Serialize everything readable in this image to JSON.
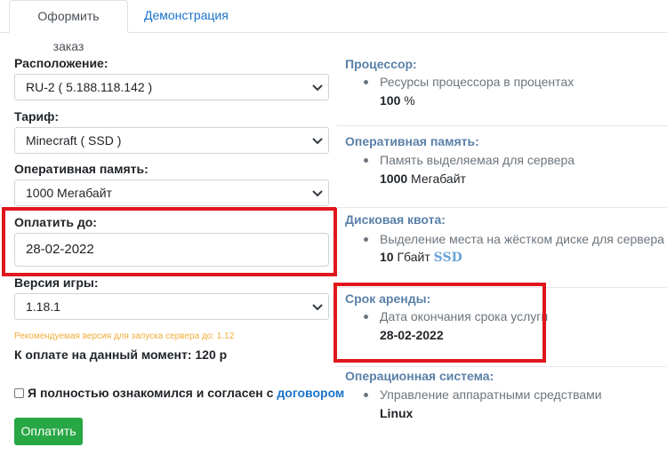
{
  "tabs": [
    {
      "label": "Оформить заказ",
      "active": true
    },
    {
      "label": "Демонстрация",
      "active": false
    }
  ],
  "form": {
    "location": {
      "label": "Расположение:",
      "value": "RU-2 ( 5.188.118.142 )"
    },
    "tariff": {
      "label": "Тариф:",
      "value": "Minecraft ( SSD )"
    },
    "ram": {
      "label": "Оперативная память:",
      "value": "1000 Мегабайт"
    },
    "pay_until": {
      "label": "Оплатить до:",
      "value": "28-02-2022"
    },
    "game_version": {
      "label": "Версия игры:",
      "value": "1.18.1"
    },
    "hint": "Рекомендуемая версия для запуска сервера до: 1.12",
    "total": "К оплате на данный момент: 120 р",
    "agree_text": "Я полностью ознакомился и согласен с",
    "agree_link": "договором",
    "pay_button": "Оплатить"
  },
  "specs": {
    "cpu": {
      "title": "Процессор:",
      "desc": "Ресурсы процессора в процентах",
      "value": "100",
      "unit": " %"
    },
    "ram": {
      "title": "Оперативная память:",
      "desc": "Память выделяемая для сервера",
      "value": "1000",
      "unit": " Мегабайт"
    },
    "disk": {
      "title": "Дисковая квота:",
      "desc": "Выделение места на жёстком диске для сервера",
      "value": "10",
      "unit": " Гбайт ",
      "badge": "SSD"
    },
    "rent": {
      "title": "Срок аренды:",
      "desc": "Дата окончания срока услуги",
      "value": "28-02-2022"
    },
    "os": {
      "title": "Операционная система:",
      "desc": "Управление аппаратными средствами",
      "value": "Linux"
    }
  },
  "colors": {
    "accent": "#1a73c9",
    "highlight": "#e0161e",
    "button": "#28a745",
    "hint": "#f0ad3b",
    "section_title": "#5a80a8"
  }
}
